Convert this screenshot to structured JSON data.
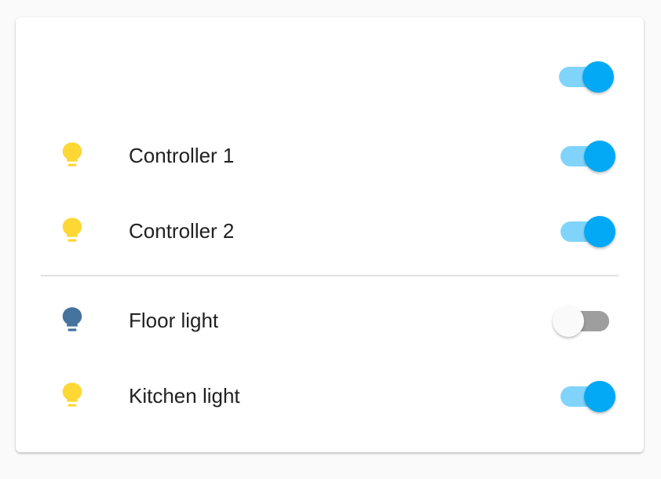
{
  "colors": {
    "accent": "#03a9f4",
    "accent_track": "#80d4fb",
    "bulb_on": "#fdd835",
    "bulb_off": "#44739e",
    "toggle_off_track": "#9e9e9e"
  },
  "header": {
    "master_toggle": {
      "state": "on"
    }
  },
  "entities": [
    {
      "label": "Controller 1",
      "icon": "lightbulb-icon",
      "state": "on"
    },
    {
      "label": "Controller 2",
      "icon": "lightbulb-icon",
      "state": "on"
    },
    {
      "label": "Floor light",
      "icon": "lightbulb-icon",
      "state": "off"
    },
    {
      "label": "Kitchen light",
      "icon": "lightbulb-icon",
      "state": "on"
    }
  ]
}
